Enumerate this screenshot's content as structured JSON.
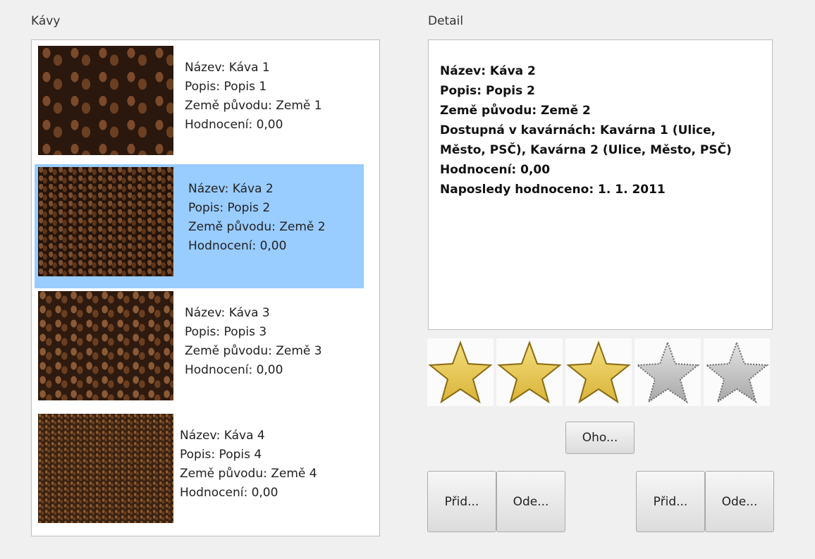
{
  "kavy_section": {
    "label": "Kávy",
    "items": [
      {
        "nazev": "Název: Káva 1",
        "popis": "Popis: Popis 1",
        "zeme": "Země původu: Země 1",
        "hodnoceni": "Hodnocení: 0,00",
        "selected": false
      },
      {
        "nazev": "Název: Káva 2",
        "popis": "Popis: Popis 2",
        "zeme": "Země původu: Země 2",
        "hodnoceni": "Hodnocení: 0,00",
        "selected": true
      },
      {
        "nazev": "Název: Káva 3",
        "popis": "Popis: Popis 3",
        "zeme": "Země původu: Země 3",
        "hodnoceni": "Hodnocení: 0,00",
        "selected": false
      },
      {
        "nazev": "Název: Káva 4",
        "popis": "Popis: Popis 4",
        "zeme": "Země původu: Země 4",
        "hodnoceni": "Hodnocení: 0,00",
        "selected": false
      }
    ]
  },
  "detail_section": {
    "label": "Detail",
    "nazev": "Název: Káva 2",
    "popis": "Popis: Popis 2",
    "zeme": "Země původu: Země 2",
    "dostupna": "Dostupná v kavárnách: Kavárna 1 (Ulice, Město, PSČ), Kavárna 2 (Ulice, Město, PSČ)",
    "hodnoceni": "Hodnocení: 0,00",
    "naposledy": "Naposledy hodnoceno: 1. 1. 2011"
  },
  "rating": {
    "filled_stars": 3,
    "total_stars": 5
  },
  "buttons": {
    "oho": "Oho...",
    "add_left": "Přid...",
    "delete_left": "Ode...",
    "add_right": "Přid...",
    "delete_right": "Ode..."
  },
  "colors": {
    "selection": "#99ccff",
    "star_gold": "#d9b43a",
    "star_gray": "#a8a8a8"
  },
  "icons": [
    "coffee-beans-image",
    "star-filled-icon",
    "star-empty-icon"
  ]
}
